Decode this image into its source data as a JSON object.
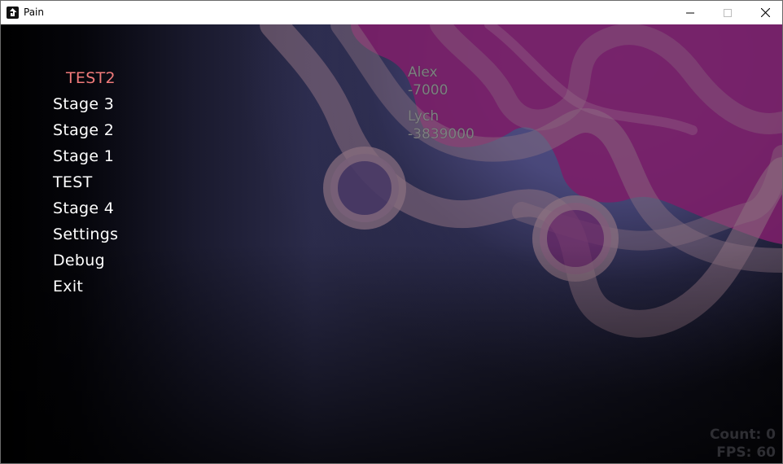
{
  "window": {
    "title": "Pain",
    "icon": "gamemaker-logo-icon",
    "controls": [
      "minimize-icon",
      "maximize-icon",
      "close-icon"
    ]
  },
  "menu": {
    "items": [
      {
        "label": "TEST2",
        "selected": true
      },
      {
        "label": "Stage 3",
        "selected": false
      },
      {
        "label": "Stage 2",
        "selected": false
      },
      {
        "label": "Stage 1",
        "selected": false
      },
      {
        "label": "TEST",
        "selected": false
      },
      {
        "label": "Stage 4",
        "selected": false
      },
      {
        "label": "Settings",
        "selected": false
      },
      {
        "label": "Debug",
        "selected": false
      },
      {
        "label": "Exit",
        "selected": false
      }
    ]
  },
  "scores": [
    {
      "name": "Alex",
      "score": "-7000"
    },
    {
      "name": "Lych",
      "score": "-3839000"
    }
  ],
  "hud": {
    "count": "Count: 0",
    "fps": "FPS: 60"
  },
  "colors": {
    "selected": "#f07a7a",
    "menu_text": "#ffffff",
    "score_text": "#7e7e82",
    "hud_text": "#2e2e33",
    "blob": "#7a2068",
    "band": "#8c7080"
  }
}
